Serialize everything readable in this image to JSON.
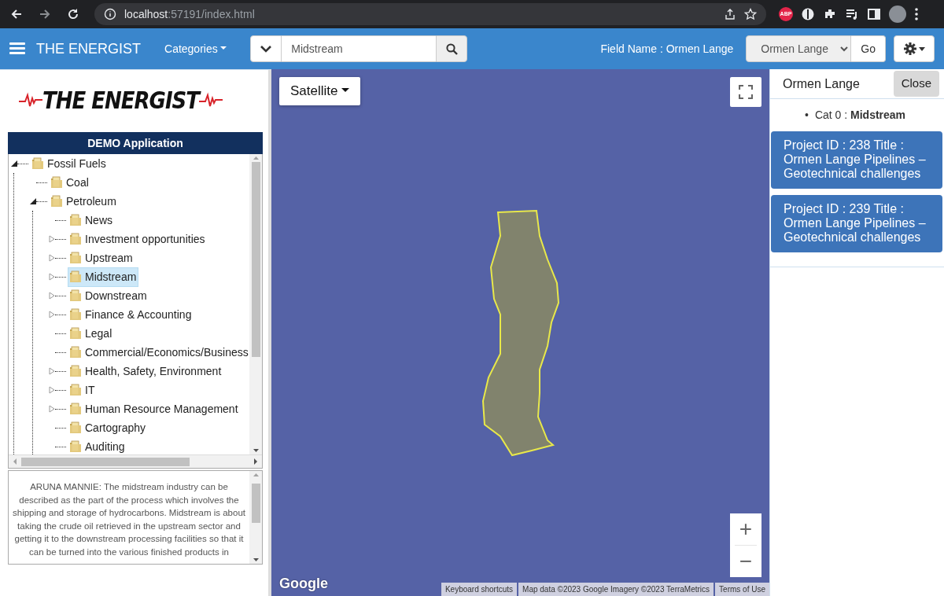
{
  "browser": {
    "host": "localhost",
    "path": ":57191/index.html",
    "extension_badge": "ABP"
  },
  "navbar": {
    "brand": "THE ENERGIST",
    "categories": "Categories",
    "search": {
      "value": "Midstream"
    },
    "field_label": "Field Name : Ormen Lange",
    "field_select": "Ormen Lange",
    "go": "Go"
  },
  "sidebar": {
    "logo": "THE ENERGIST",
    "header": "DEMO Application",
    "tree": [
      {
        "label": "Fossil Fuels",
        "kind": "branch",
        "expanded": true,
        "selected": false,
        "children": [
          {
            "label": "Coal",
            "kind": "leaf",
            "selected": false
          },
          {
            "label": "Petroleum",
            "kind": "branch",
            "expanded": true,
            "selected": false,
            "children": [
              {
                "label": "News",
                "kind": "leaf",
                "selected": false
              },
              {
                "label": "Investment opportunities",
                "kind": "branch",
                "expanded": false,
                "selected": false
              },
              {
                "label": "Upstream",
                "kind": "branch",
                "expanded": false,
                "selected": false
              },
              {
                "label": "Midstream",
                "kind": "branch",
                "expanded": false,
                "selected": true
              },
              {
                "label": "Downstream",
                "kind": "branch",
                "expanded": false,
                "selected": false
              },
              {
                "label": "Finance & Accounting",
                "kind": "branch",
                "expanded": false,
                "selected": false
              },
              {
                "label": "Legal",
                "kind": "leaf",
                "selected": false
              },
              {
                "label": "Commercial/Economics/Business",
                "kind": "leaf",
                "selected": false
              },
              {
                "label": "Health, Safety, Environment",
                "kind": "branch",
                "expanded": false,
                "selected": false
              },
              {
                "label": "IT",
                "kind": "branch",
                "expanded": false,
                "selected": false
              },
              {
                "label": "Human Resource Management",
                "kind": "branch",
                "expanded": false,
                "selected": false
              },
              {
                "label": "Cartography",
                "kind": "leaf",
                "selected": false
              },
              {
                "label": "Auditing",
                "kind": "leaf",
                "selected": false
              }
            ]
          }
        ]
      }
    ],
    "description": "ARUNA MANNIE: The midstream industry can be described as the part of the process which involves the shipping and storage of hydrocarbons. Midstream is about taking the crude oil retrieved in the upstream sector and getting it to the downstream processing facilities so that it can be turned into the various finished products in"
  },
  "map": {
    "map_type": "Satellite",
    "zoom_in": "+",
    "zoom_out": "−",
    "logo": "Google",
    "attribution": [
      "Keyboard shortcuts",
      "Map data ©2023 Google Imagery ©2023 TerraMetrics",
      "Terms of Use"
    ]
  },
  "info_panel": {
    "title": "Ormen Lange",
    "close": "Close",
    "category_bullet": "•",
    "category": "Cat 0 : **Midstream**",
    "projects": [
      "Project ID : 238 Title : Ormen Lange Pipelines – Geotechnical challenges",
      "Project ID : 239 Title : Ormen Lange Pipelines – Geotechnical challenges"
    ]
  }
}
